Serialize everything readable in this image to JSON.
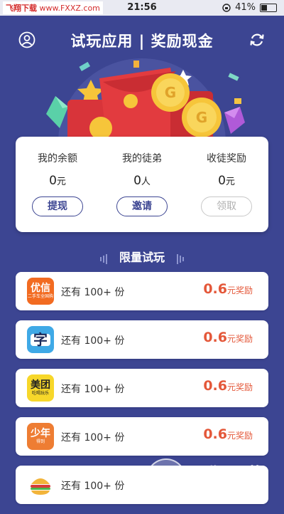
{
  "status_bar": {
    "watermark_brand": "飞翔下载",
    "watermark_url": "www.FXXZ.com",
    "time": "21:56",
    "battery": "41%"
  },
  "header": {
    "title": "试玩应用 | 奖励现金",
    "left_icon": "user-icon",
    "right_icon": "refresh-icon"
  },
  "balance": {
    "items": [
      {
        "label": "我的余额",
        "value": "0",
        "unit": "元",
        "button": "提现",
        "enabled": true
      },
      {
        "label": "我的徒弟",
        "value": "0",
        "unit": "人",
        "button": "邀请",
        "enabled": true
      },
      {
        "label": "收徒奖励",
        "value": "0",
        "unit": "元",
        "button": "领取",
        "enabled": false
      }
    ]
  },
  "section_title": "限量试玩",
  "apps": [
    {
      "icon_text": "优信",
      "icon_sub": "二手车全国购",
      "icon_bg": "#f26b21",
      "icon_fg": "#ffffff",
      "remaining": "还有 100+ 份",
      "reward_amount": "0.6",
      "reward_unit": "元奖励"
    },
    {
      "icon_text": "字",
      "icon_sub": "",
      "icon_bg": "#3fa9e6",
      "icon_fg": "#1c2a5a",
      "remaining": "还有 100+ 份",
      "reward_amount": "0.6",
      "reward_unit": "元奖励"
    },
    {
      "icon_text": "美团",
      "icon_sub": "吃喝玩乐",
      "icon_bg": "#f7d72a",
      "icon_fg": "#222222",
      "remaining": "还有 100+ 份",
      "reward_amount": "0.6",
      "reward_unit": "元奖励"
    },
    {
      "icon_text": "少年",
      "icon_sub": "得到",
      "icon_bg": "#ee7d33",
      "icon_fg": "#ffffff",
      "remaining": "还有 100+ 份",
      "reward_amount": "0.6",
      "reward_unit": "元奖励"
    },
    {
      "icon_text": "",
      "icon_sub": "",
      "icon_bg": "#ffffff",
      "icon_fg": "#333333",
      "remaining": "还有 100+ 份",
      "reward_amount": "",
      "reward_unit": ""
    }
  ],
  "watermark_bottom": {
    "brand": "飞翔下载",
    "url": "www.FXXZ.com"
  },
  "colors": {
    "background": "#3c4592",
    "accent": "#3c4592",
    "reward": "#e4583a"
  }
}
